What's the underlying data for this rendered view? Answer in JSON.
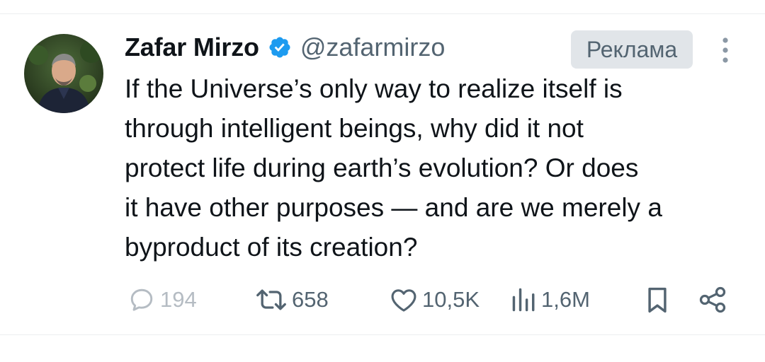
{
  "author": {
    "display_name": "Zafar Mirzo",
    "handle": "@zafarmirzo",
    "verified": true,
    "avatar_icon": "profile-photo"
  },
  "badge": {
    "label": "Реклама"
  },
  "tweet": {
    "text": "If the Universe’s only way to realize itself is\nthrough intelligent beings, why did it not\nprotect life during earth’s evolution? Or does\nit have other purposes — and are we merely a\nbyproduct of its creation?"
  },
  "actions": {
    "replies": "194",
    "retweets": "658",
    "likes": "10,5K",
    "views": "1,6M"
  },
  "colors": {
    "text": "#0f1419",
    "muted": "#536471",
    "verified_blue": "#1d9bf0",
    "badge_bg": "#e1e5e9"
  }
}
